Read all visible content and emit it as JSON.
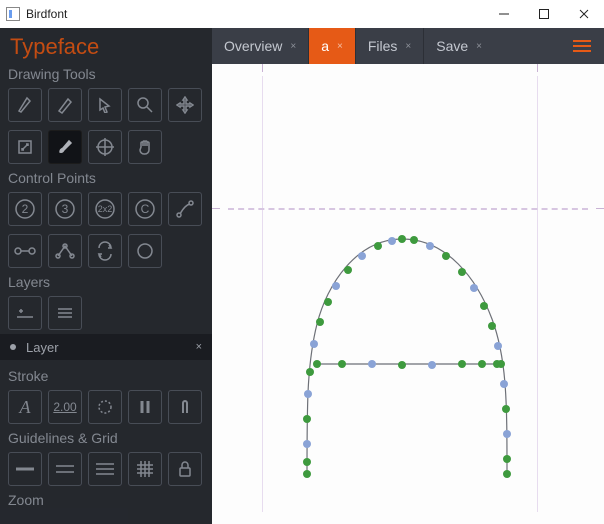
{
  "window": {
    "title": "Birdfont"
  },
  "brand": "Typeface",
  "sections": {
    "drawing": "Drawing Tools",
    "control": "Control Points",
    "layers": "Layers",
    "stroke": "Stroke",
    "guides": "Guidelines & Grid",
    "zoom": "Zoom"
  },
  "layer": {
    "name": "Layer"
  },
  "stroke": {
    "width": "2.00"
  },
  "tabs": [
    {
      "label": "Overview",
      "active": false
    },
    {
      "label": "a",
      "active": true
    },
    {
      "label": "Files",
      "active": false
    },
    {
      "label": "Save",
      "active": false
    }
  ],
  "control_point_labels": {
    "two": "2",
    "three": "3",
    "twobytwo": "2x2",
    "c": "C"
  }
}
